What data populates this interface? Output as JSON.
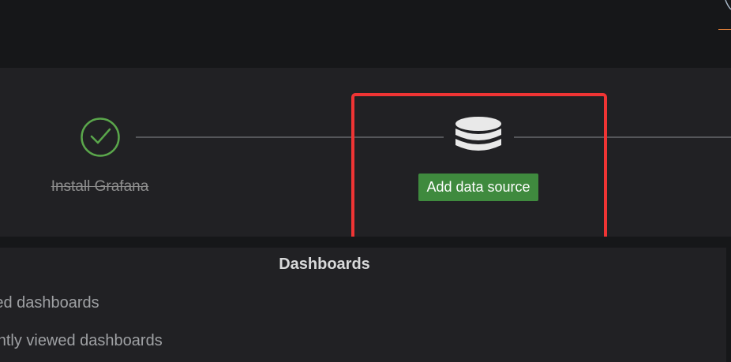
{
  "getting_started": {
    "steps": [
      {
        "label": "Install Grafana",
        "status": "done",
        "icon": "check-circle-icon"
      },
      {
        "label": "Add data source",
        "status": "current",
        "icon": "database-icon"
      }
    ]
  },
  "dashboards_panel": {
    "title": "Dashboards",
    "links": [
      "Starred dashboards",
      "Recently viewed dashboards"
    ]
  },
  "colors": {
    "accent_green": "#3f8a3e",
    "check_green": "#5aa64b",
    "highlight_red": "#ef3434",
    "topbar_accent_orange": "#e8833a"
  }
}
